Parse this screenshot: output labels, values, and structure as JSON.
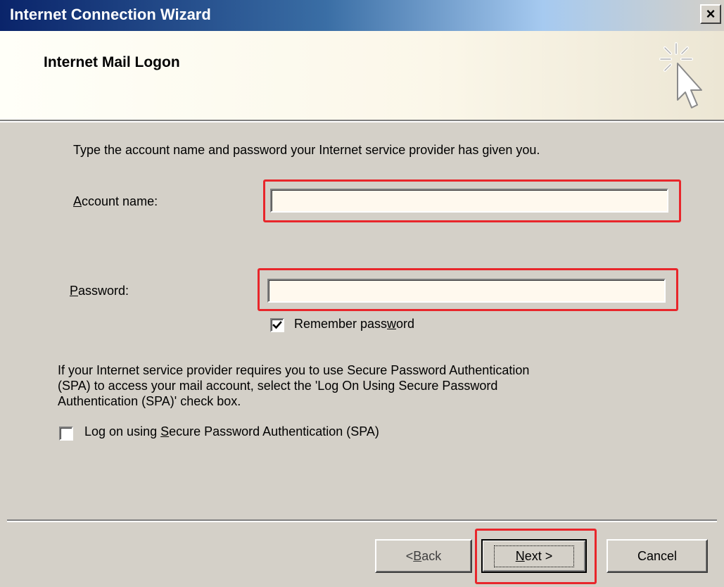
{
  "window": {
    "title": "Internet Connection Wizard",
    "close_label": "×"
  },
  "header": {
    "title": "Internet Mail Logon"
  },
  "body": {
    "intro": "Type the account name and password your Internet service provider has given you.",
    "account": {
      "label_pre": "",
      "label_ul": "A",
      "label_post": "ccount name:",
      "value": ""
    },
    "password": {
      "label_pre": "",
      "label_ul": "P",
      "label_post": "assword:",
      "value": ""
    },
    "remember": {
      "label_pre": "Remember pass",
      "label_ul": "w",
      "label_post": "ord",
      "checked": true
    },
    "spa_paragraph": "If your Internet service provider requires you to use Secure Password Authentication\n(SPA) to access your mail account, select the 'Log On Using Secure Password\nAuthentication (SPA)' check box.",
    "spa": {
      "label_pre": "Log on using ",
      "label_ul": "S",
      "label_post": "ecure Password Authentication (SPA)",
      "checked": false
    }
  },
  "buttons": {
    "back": {
      "pre": "< ",
      "ul": "B",
      "post": "ack"
    },
    "next": {
      "pre": "",
      "ul": "N",
      "post": "ext >"
    },
    "cancel": "Cancel"
  },
  "colors": {
    "highlight": "#e8262b",
    "title_bar_start": "#0a246a",
    "dialog_bg": "#d4d0c8"
  }
}
